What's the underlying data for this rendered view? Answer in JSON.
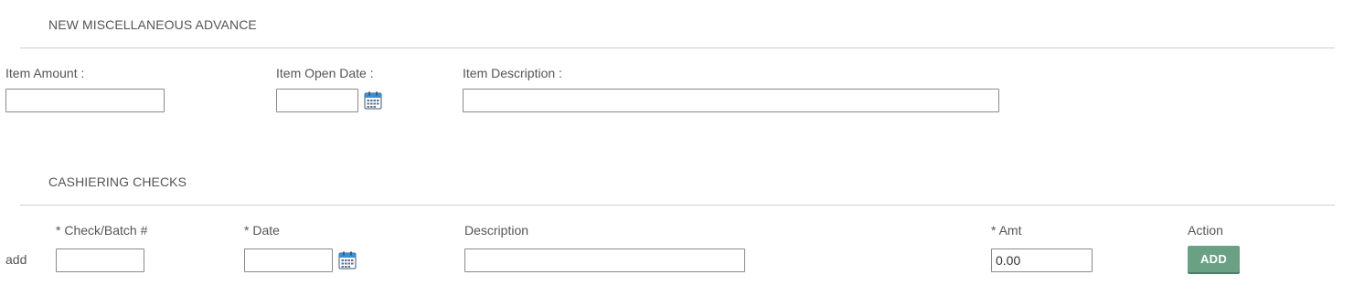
{
  "advance": {
    "title": "NEW MISCELLANEOUS ADVANCE",
    "item_amount_label": "Item Amount :",
    "item_amount_value": "",
    "item_open_date_label": "Item Open Date :",
    "item_open_date_value": "",
    "item_description_label": "Item Description :",
    "item_description_value": ""
  },
  "checks": {
    "title": "CASHIERING CHECKS",
    "headers": {
      "check_batch": "* Check/Batch #",
      "date": "* Date",
      "description": "Description",
      "amt": "* Amt",
      "action": "Action"
    },
    "row": {
      "label": "add",
      "check_batch_value": "",
      "date_value": "",
      "description_value": "",
      "amt_value": "0.00",
      "add_button_label": "ADD"
    }
  },
  "icons": {
    "calendar": "calendar-icon"
  },
  "colors": {
    "add_button": "#6aa184",
    "calendar_header": "#3b8fd6"
  }
}
